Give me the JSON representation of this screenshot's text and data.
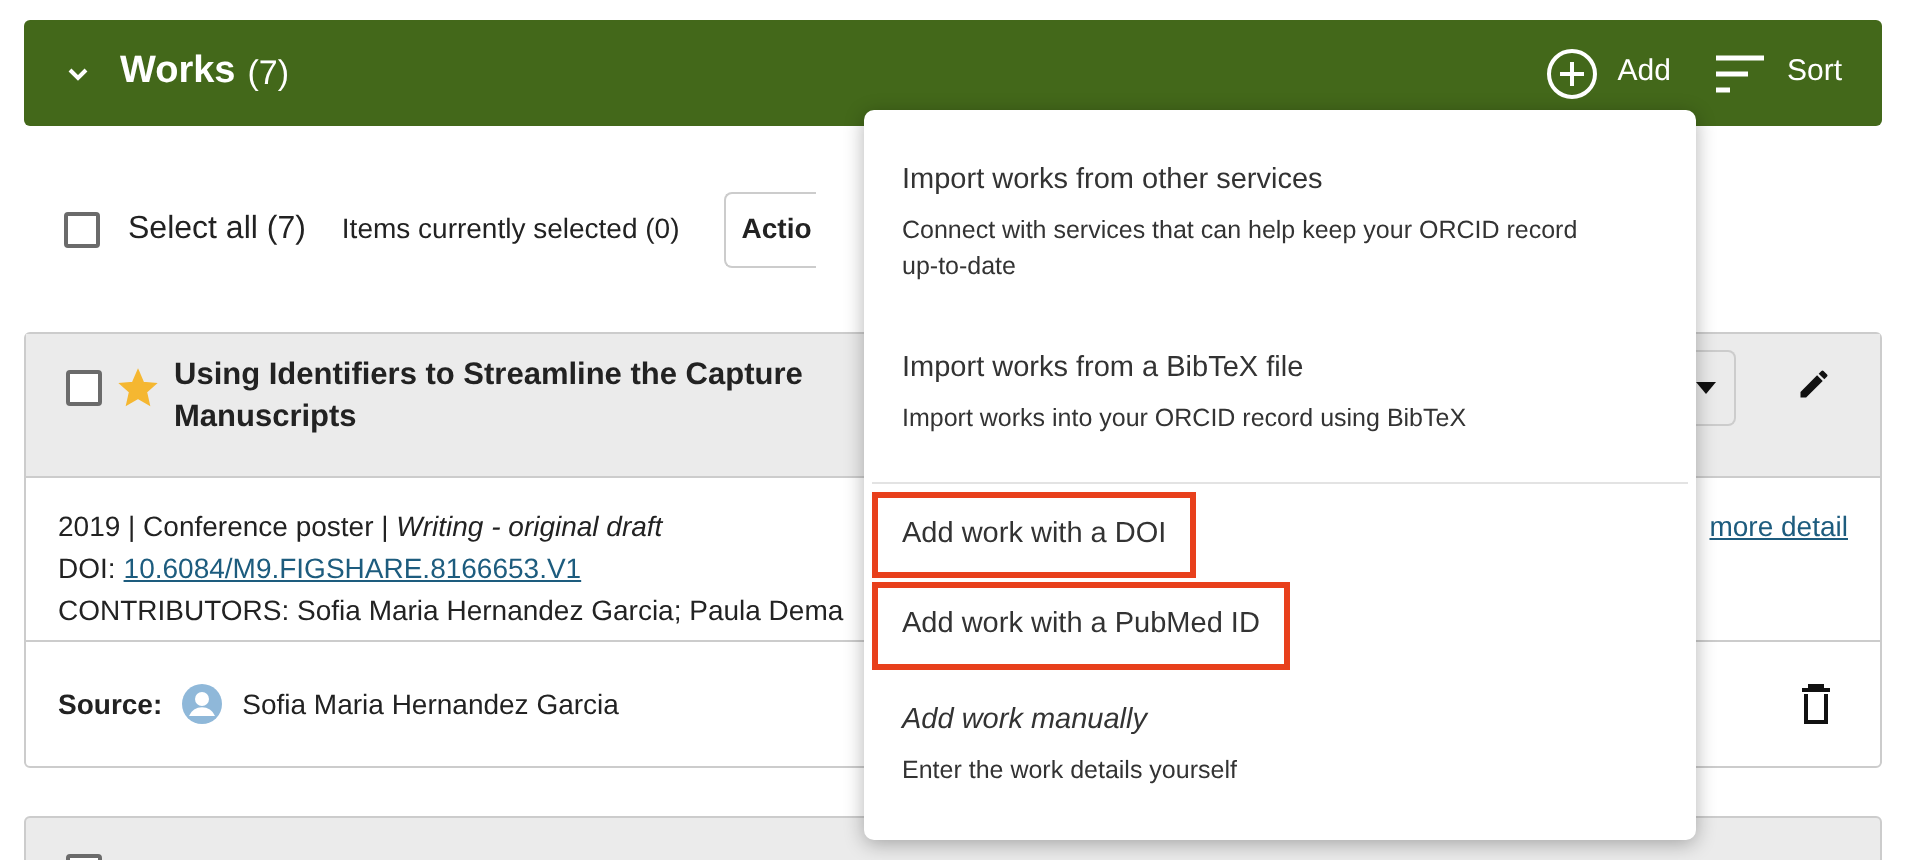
{
  "section": {
    "title": "Works",
    "count": "(7)",
    "expanded": true,
    "actions": [
      {
        "kind": "add",
        "label": "Add"
      },
      {
        "kind": "sort",
        "label": "Sort"
      }
    ]
  },
  "toolbar": {
    "select_all": {
      "label": "Select all (7)",
      "checked": false
    },
    "selected_count": "Items currently selected (0)",
    "actions_button": "Actio"
  },
  "works": [
    {
      "checked": false,
      "favorite": true,
      "title_lines": [
        "Using Identifiers to Streamline the Capture",
        "Manuscripts"
      ],
      "meta": "2019 | Conference poster | *Writing - original draft*",
      "doi_label": "DOI:",
      "doi": "10.6084/M9.FIGSHARE.8166653.V1",
      "contributors": "CONTRIBUTORS: Sofia Maria Hernandez Garcia; Paula Dema",
      "more_link": "more detail",
      "source_label": "Source:",
      "source_name": "Sofia Maria Hernandez Garcia"
    }
  ],
  "next_work": {
    "checked": false
  },
  "add_menu": [
    {
      "title": "Import works from other services",
      "description": "Connect with services that can help keep your ORCID record up-to-date",
      "highlighted": false,
      "italic": false
    },
    {
      "title": "Import works from a BibTeX file",
      "description": "Import works into your ORCID record using BibTeX",
      "highlighted": false,
      "italic": false
    },
    {
      "title": "Add work with a DOI",
      "highlighted": true,
      "italic": false
    },
    {
      "title": "Add work with a PubMed ID",
      "highlighted": true,
      "italic": false
    },
    {
      "title": "Add work manually",
      "description": "Enter the work details yourself",
      "highlighted": false,
      "italic": true
    }
  ]
}
